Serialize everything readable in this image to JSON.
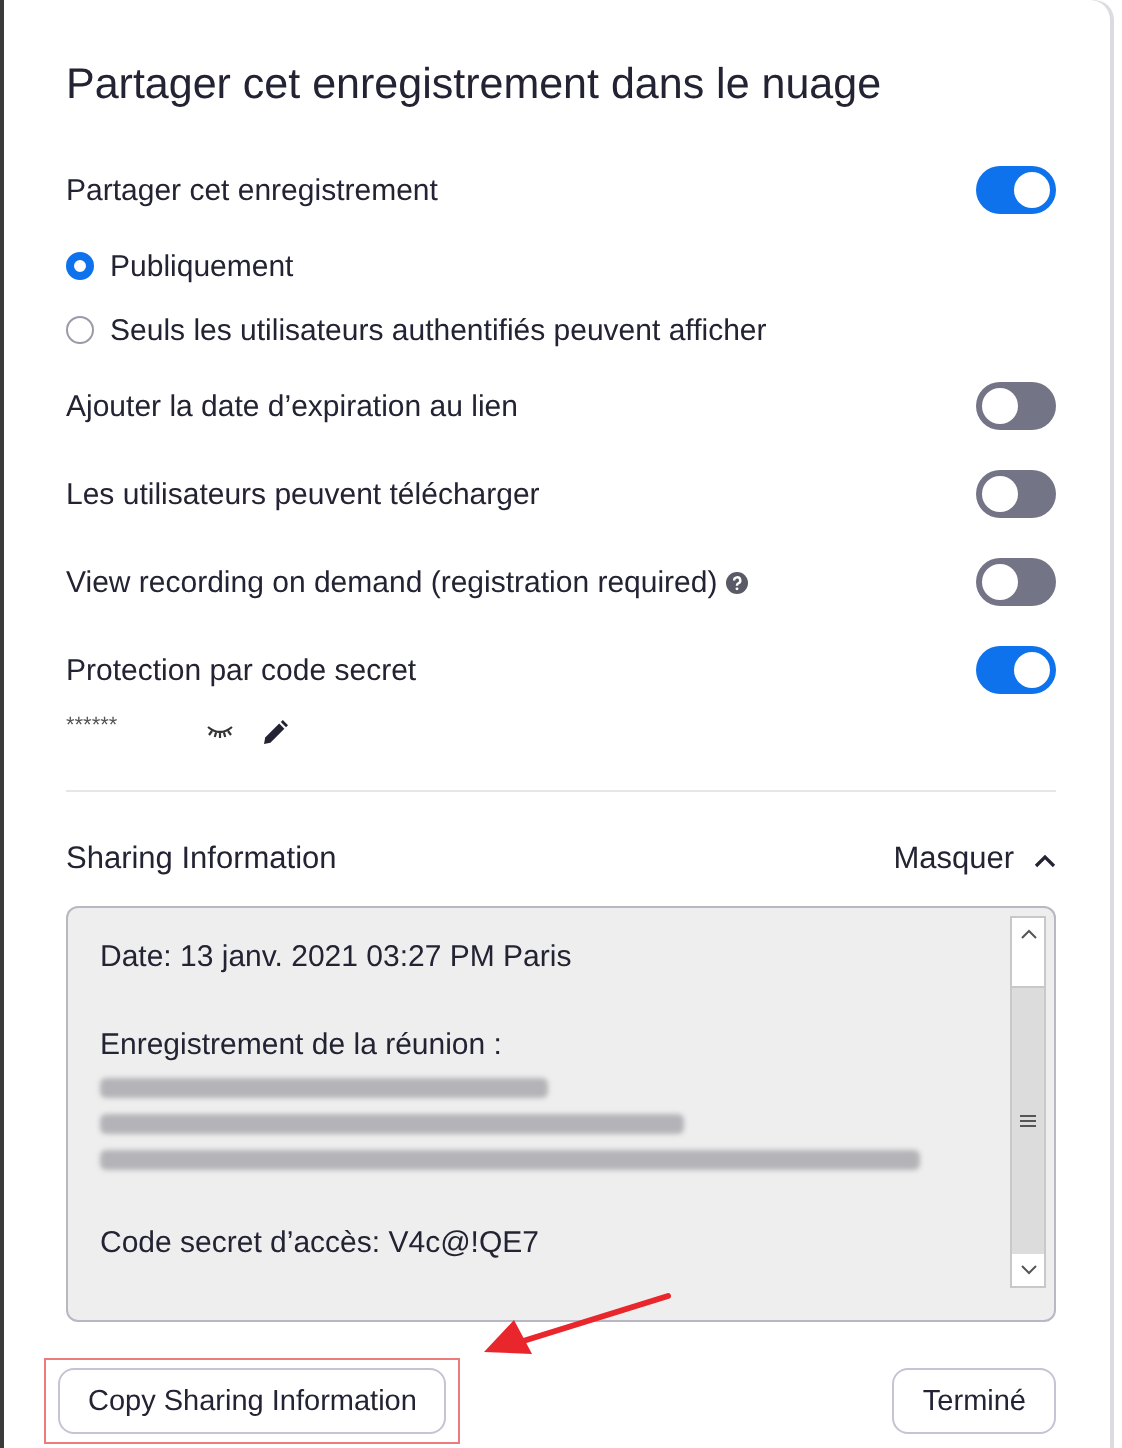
{
  "dialog": {
    "title": "Partager cet enregistrement dans le nuage"
  },
  "settings": [
    {
      "kind": "toggle",
      "label": "Partager cet enregistrement",
      "on": true,
      "help": false
    },
    {
      "kind": "radio",
      "label": "Publiquement",
      "selected": true
    },
    {
      "kind": "radio",
      "label": "Seuls les utilisateurs authentifiés peuvent afficher",
      "selected": false
    },
    {
      "kind": "toggle",
      "label": "Ajouter la date d’expiration au lien",
      "on": false,
      "help": false
    },
    {
      "kind": "toggle",
      "label": "Les utilisateurs peuvent télécharger",
      "on": false,
      "help": false
    },
    {
      "kind": "toggle",
      "label": "View recording on demand (registration required)",
      "on": false,
      "help": true
    },
    {
      "kind": "toggle",
      "label": "Protection par code secret",
      "on": true,
      "help": false
    }
  ],
  "password": {
    "value": "******"
  },
  "sharing": {
    "title": "Sharing Information",
    "toggle_label": "Masquer",
    "expanded": true,
    "paragraphs": [
      {
        "items": [
          {
            "kind": "text",
            "text": "Date: 13 janv. 2021 03:27 PM Paris"
          }
        ]
      },
      {
        "items": [
          {
            "kind": "text",
            "text": "Enregistrement de la réunion :"
          },
          {
            "kind": "blurred"
          }
        ]
      },
      {
        "items": [
          {
            "kind": "text",
            "text": "Code secret d’accès: V4c@!QE7"
          }
        ]
      }
    ]
  },
  "buttons": [
    {
      "label": "Copy Sharing Information",
      "highlighted": true
    },
    {
      "label": "Terminé",
      "highlighted": false
    }
  ]
}
